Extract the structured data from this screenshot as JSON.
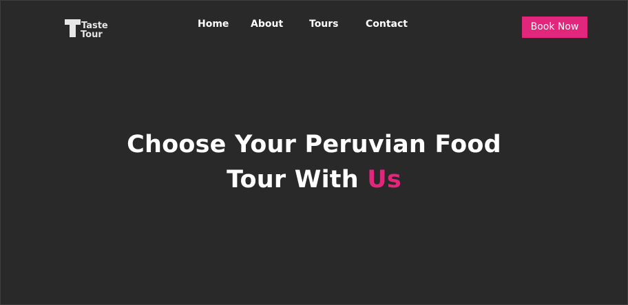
{
  "brand": {
    "logo_line1": "Taste",
    "logo_line2": "Tour"
  },
  "nav": {
    "items": [
      {
        "label": "Home"
      },
      {
        "label": "About"
      },
      {
        "label": "Tours"
      },
      {
        "label": "Contact"
      }
    ],
    "cta_label": "Book Now"
  },
  "hero": {
    "line1": "Choose Your Peruvian Food",
    "line2_prefix": "Tour With",
    "line2_accent": "Us"
  },
  "colors": {
    "background": "#292929",
    "accent": "#e2267b",
    "text": "#ffffff",
    "logo": "#e6e6e6"
  }
}
